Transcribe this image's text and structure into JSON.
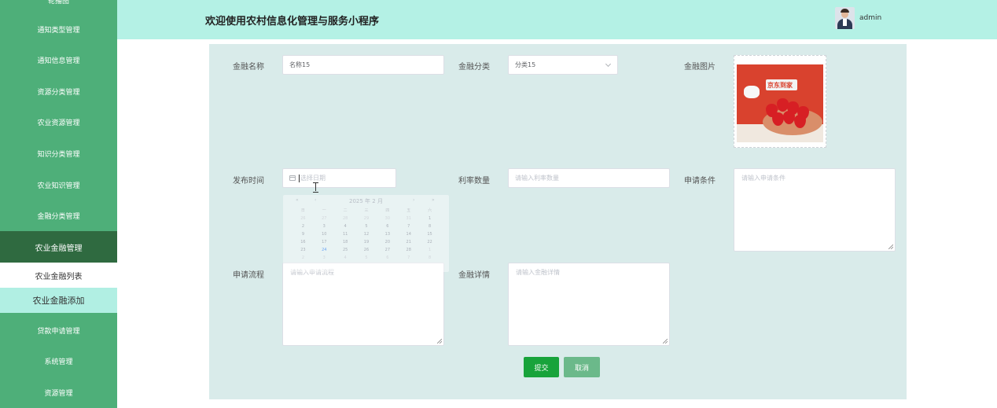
{
  "app": {
    "title": "欢迎使用农村信息化管理与服务小程序",
    "username": "admin"
  },
  "sidebar": {
    "items": [
      {
        "label": "轮播图"
      },
      {
        "label": "通知类型管理"
      },
      {
        "label": "通知信息管理"
      },
      {
        "label": "资源分类管理"
      },
      {
        "label": "农业资源管理"
      },
      {
        "label": "知识分类管理"
      },
      {
        "label": "农业知识管理"
      },
      {
        "label": "金融分类管理"
      },
      {
        "label": "农业金融管理"
      },
      {
        "label": "贷款申请管理"
      },
      {
        "label": "系统管理"
      },
      {
        "label": "资源管理"
      }
    ],
    "submenu": [
      {
        "label": "农业金融列表"
      },
      {
        "label": "农业金融添加"
      }
    ]
  },
  "form": {
    "name_label": "金融名称",
    "name_value": "名称15",
    "category_label": "金融分类",
    "category_value": "分类15",
    "image_label": "金融图片",
    "image_text": "京东到家",
    "date_label": "发布时间",
    "date_placeholder": "选择日期",
    "rate_label": "利率数量",
    "rate_placeholder": "请输入利率数量",
    "conditions_label": "申请条件",
    "conditions_placeholder": "请输入申请条件",
    "process_label": "申请流程",
    "process_placeholder": "请输入申请流程",
    "details_label": "金融详情",
    "details_placeholder": "请输入金融详情",
    "submit_label": "提交",
    "cancel_label": "取消"
  },
  "datepicker": {
    "title": "2025 年 2 月",
    "nav": [
      "«",
      "‹",
      "›",
      "»"
    ],
    "weekdays": [
      "日",
      "一",
      "二",
      "三",
      "四",
      "五",
      "六"
    ],
    "days": [
      "26",
      "27",
      "28",
      "29",
      "30",
      "31",
      "1",
      "2",
      "3",
      "4",
      "5",
      "6",
      "7",
      "8",
      "9",
      "10",
      "11",
      "12",
      "13",
      "14",
      "15",
      "16",
      "17",
      "18",
      "19",
      "20",
      "21",
      "22",
      "23",
      "24",
      "25",
      "26",
      "27",
      "28",
      "1",
      "2",
      "3",
      "4",
      "5",
      "6",
      "7",
      "8"
    ],
    "today": "24"
  },
  "colors": {
    "sidebar": "#4eaf79",
    "sidebar_active": "#2f6a40",
    "header": "#b4f1e5",
    "panel": "#d9ebea",
    "submit": "#18a33b",
    "cancel": "#6bb98a"
  }
}
